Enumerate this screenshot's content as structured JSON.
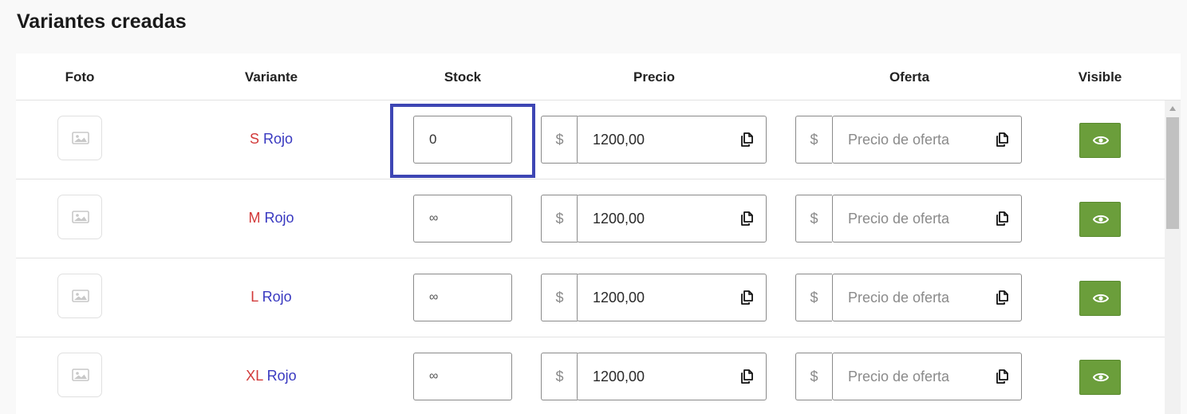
{
  "page": {
    "title": "Variantes creadas"
  },
  "table": {
    "headers": {
      "foto": "Foto",
      "variante": "Variante",
      "stock": "Stock",
      "precio": "Precio",
      "oferta": "Oferta",
      "visible": "Visible"
    },
    "currency_symbol": "$",
    "oferta_placeholder": "Precio de oferta",
    "rows": [
      {
        "size": "S",
        "color": "Rojo",
        "stock": "0",
        "precio": "1200,00",
        "visible": true,
        "focused": true
      },
      {
        "size": "M",
        "color": "Rojo",
        "stock": "∞",
        "precio": "1200,00",
        "visible": true,
        "focused": false
      },
      {
        "size": "L",
        "color": "Rojo",
        "stock": "∞",
        "precio": "1200,00",
        "visible": true,
        "focused": false
      },
      {
        "size": "XL",
        "color": "Rojo",
        "stock": "∞",
        "precio": "1200,00",
        "visible": true,
        "focused": false
      }
    ]
  },
  "icons": {
    "photo": "image-placeholder-icon",
    "copy": "copy-icon",
    "visible": "eye-icon"
  },
  "colors": {
    "size_text": "#d23a3a",
    "color_text": "#3838c0",
    "visible_button": "#6b9e3b",
    "focus_ring": "#3e46b4"
  }
}
